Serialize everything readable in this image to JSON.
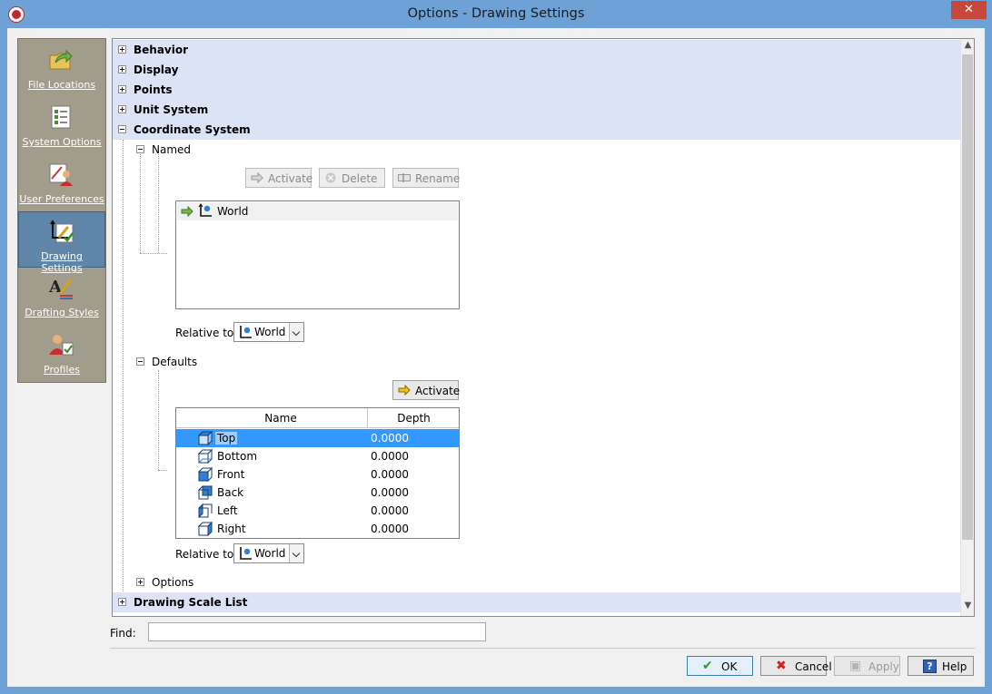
{
  "window": {
    "title": "Options - Drawing Settings",
    "close_glyph": "✕"
  },
  "nav": {
    "items": [
      {
        "label": "File Locations",
        "icon": "folder-arrow-icon"
      },
      {
        "label": "System Options",
        "icon": "checklist-icon"
      },
      {
        "label": "User Preferences",
        "icon": "user-preferences-icon"
      },
      {
        "label": "Drawing Settings",
        "icon": "drawing-settings-icon",
        "active": true
      },
      {
        "label": "Drafting Styles",
        "icon": "drafting-styles-icon"
      },
      {
        "label": "Profiles",
        "icon": "profiles-icon"
      }
    ]
  },
  "tree": {
    "categories": {
      "behavior": "Behavior",
      "display": "Display",
      "points": "Points",
      "unit_system": "Unit System",
      "coordinate_system": "Coordinate System",
      "drawing_scale_list": "Drawing Scale List"
    },
    "named": {
      "label": "Named",
      "buttons": {
        "activate": "Activate",
        "delete": "Delete",
        "rename": "Rename"
      },
      "list_item": "World",
      "relative_label": "Relative to:",
      "relative_value": "World"
    },
    "defaults": {
      "label": "Defaults",
      "activate": "Activate",
      "columns": {
        "name": "Name",
        "depth": "Depth"
      },
      "rows": [
        {
          "name": "Top",
          "depth": "0.0000"
        },
        {
          "name": "Bottom",
          "depth": "0.0000"
        },
        {
          "name": "Front",
          "depth": "0.0000"
        },
        {
          "name": "Back",
          "depth": "0.0000"
        },
        {
          "name": "Left",
          "depth": "0.0000"
        },
        {
          "name": "Right",
          "depth": "0.0000"
        }
      ],
      "relative_label": "Relative to:",
      "relative_value": "World"
    },
    "options_label": "Options"
  },
  "find": {
    "label": "Find:",
    "value": ""
  },
  "buttons": {
    "ok": "OK",
    "cancel": "Cancel",
    "apply": "Apply",
    "help": "Help"
  },
  "colors": {
    "selection": "#3399ff",
    "category_bg": "#dde3f6",
    "nav_bg": "#a29c8c",
    "nav_active": "#5f86a8"
  }
}
